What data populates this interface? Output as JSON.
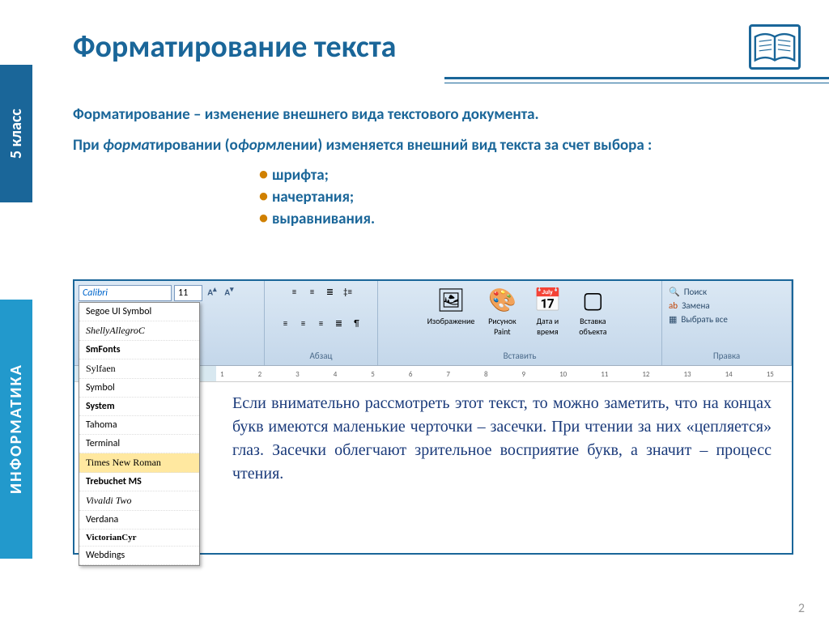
{
  "sidebar": {
    "grade": "5 класс",
    "subject": "ИНФОРМАТИКА"
  },
  "title": "Форматирование текста",
  "definition": "Форматирование – изменение внешнего вида текстового документа.",
  "paragraph": {
    "p1": "При ",
    "it1": "форма",
    "p2": "тировании (о",
    "it2": "форм",
    "p3": "лении) изменяется внешний вид текста за счет выбора :"
  },
  "bullets": [
    "шрифта;",
    "начертания;",
    "выравнивания."
  ],
  "word": {
    "font_selected": "Calibri",
    "font_size": "11",
    "dropdown": [
      {
        "name": "Segoe UI Symbol",
        "cls": ""
      },
      {
        "name": "ShellyAllegroC",
        "cls": "script"
      },
      {
        "name": "SmFonts",
        "cls": "bold"
      },
      {
        "name": "Sylfaen",
        "cls": "serif"
      },
      {
        "name": "Symbol",
        "cls": ""
      },
      {
        "name": "System",
        "cls": "bold"
      },
      {
        "name": "Tahoma",
        "cls": ""
      },
      {
        "name": "Terminal",
        "cls": ""
      },
      {
        "name": "Times New Roman",
        "cls": "serif hl"
      },
      {
        "name": "Trebuchet MS",
        "cls": "bold"
      },
      {
        "name": "Vivaldi Two",
        "cls": "script"
      },
      {
        "name": "Verdana",
        "cls": ""
      },
      {
        "name": "VictorianCyr",
        "cls": "smcap"
      },
      {
        "name": "Webdings",
        "cls": ""
      }
    ],
    "groups": {
      "paragraph": "Абзац",
      "insert": "Вставить",
      "edit": "Правка",
      "image": "Изображение",
      "paint": "Рисунок Paint",
      "datetime": "Дата и время",
      "object": "Вставка объекта",
      "find": "Поиск",
      "replace": "Замена",
      "selectall": "Выбрать все"
    },
    "ruler_marks": [
      "1",
      "2",
      "3",
      "4",
      "5",
      "6",
      "7",
      "8",
      "9",
      "10",
      "11",
      "12",
      "13",
      "14",
      "15"
    ],
    "doctext": "Если внимательно рассмотреть этот текст, то можно заметить, что на концах букв имеются маленькие черточки – засечки. При чтении за них «цепляется» глаз. Засечки облегчают зрительное восприятие букв, а значит – процесс чтения."
  },
  "pagenum": "2"
}
